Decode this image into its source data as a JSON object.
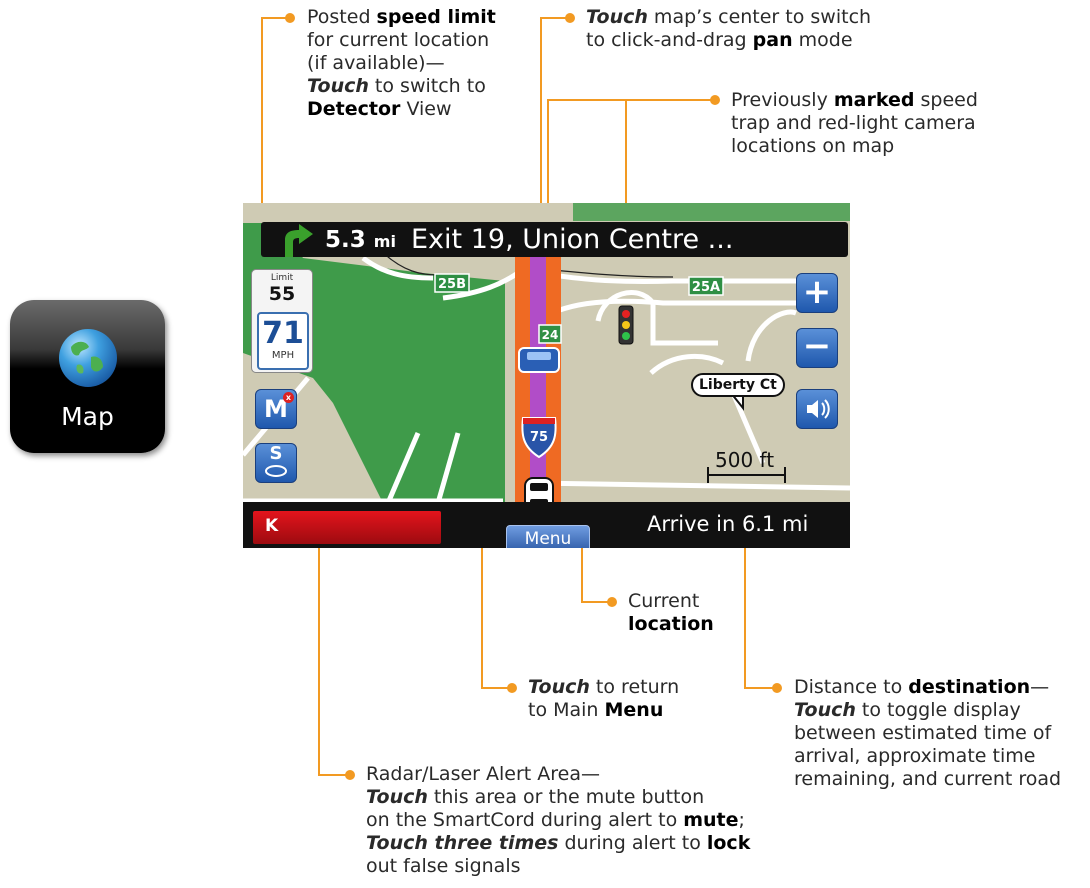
{
  "app_icon": {
    "label": "Map",
    "icon": "globe-icon"
  },
  "annotations": {
    "speed_limit": {
      "l1_pre": "Posted ",
      "l1_bold": "speed limit",
      "l2": "for current location",
      "l3": "(if available)—",
      "l4_italic": "Touch",
      "l4_rest": " to switch to",
      "l5_bold": "Detector",
      "l5_rest": " View"
    },
    "pan": {
      "l1_italic": "Touch",
      "l1_rest": " map’s center to switch",
      "l2_pre": "to click-and-drag ",
      "l2_bold": "pan",
      "l2_rest": " mode"
    },
    "marked": {
      "l1_pre": "Previously ",
      "l1_bold": "marked",
      "l1_rest": " speed",
      "l2": "trap and red-light camera",
      "l3": "locations on map"
    },
    "current": {
      "l1": "Current",
      "l2_bold": "location"
    },
    "menu": {
      "l1_italic": "Touch",
      "l1_rest": " to return",
      "l2_pre": "to Main ",
      "l2_bold": "Menu"
    },
    "destination": {
      "l1_pre": "Distance to ",
      "l1_bold": "destination",
      "l1_rest": "—",
      "l2_italic": "Touch",
      "l2_rest": " to toggle display",
      "l3": "between estimated time of",
      "l4": "arrival, approximate time",
      "l5": "remaining, and current road"
    },
    "radar": {
      "l1": "Radar/Laser Alert Area—",
      "l2_italic": "Touch",
      "l2_rest": " this area or the mute button",
      "l3_pre": "on the SmartCord during alert to ",
      "l3_bold": "mute",
      "l3_rest": ";",
      "l4_italic": "Touch three times",
      "l4_rest": " during alert to ",
      "l4_bold": "lock",
      "l5": "out false signals"
    }
  },
  "screen": {
    "route": {
      "distance": "5.3",
      "unit": "mi",
      "name": "Exit 19, Union Centre ..."
    },
    "speed_limit": {
      "label": "Limit",
      "value": "55"
    },
    "speed": {
      "value": "71",
      "unit": "MPH"
    },
    "mark_button": {
      "label": "M",
      "badge": "x"
    },
    "compass_button": {
      "label": "S"
    },
    "zoom_in": {
      "label": "+"
    },
    "zoom_out": {
      "label": "−"
    },
    "road_labels": {
      "exit_a": "25B",
      "exit_b": "25A",
      "exit_c": "24",
      "interstate": "75",
      "street": "Liberty Ct"
    },
    "scale": "500 ft",
    "alert": {
      "band": "K"
    },
    "menu": "Menu",
    "arrive": "Arrive in 6.1 mi"
  },
  "colors": {
    "leader": "#f29a22",
    "map_land": "#cfcbb4",
    "park_green": "#3f9b4a",
    "route_orange": "#ef6a23",
    "route_purple": "#b14dc8",
    "alert_red": "#e3141c",
    "button_blue": "#2d65c2"
  }
}
